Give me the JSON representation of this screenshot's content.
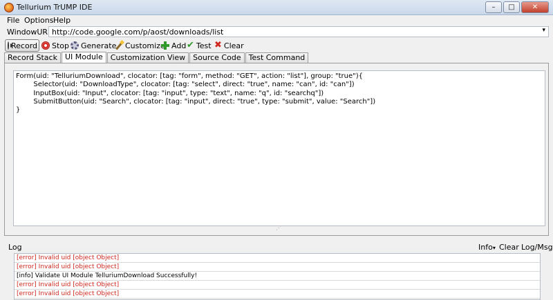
{
  "window": {
    "title": "Tellurium TrUMP IDE",
    "buttons": {
      "minimize": "–",
      "maximize": "□",
      "close": "✕"
    }
  },
  "menu": [
    "File",
    "Options",
    "Help"
  ],
  "url": {
    "label": "WindowURL",
    "value": "http://code.google.com/p/aost/downloads/list",
    "dropdown": "▾"
  },
  "toolbar": {
    "record": "Record",
    "stop": "Stop",
    "generate": "Generate",
    "customize": "Customize",
    "add": "Add",
    "test": "Test",
    "clear": "Clear"
  },
  "tabs": [
    "Record Stack",
    "UI Module",
    "Customization View",
    "Source Code",
    "Test Command"
  ],
  "active_tab": "UI Module",
  "code": "Form(uid: \"TelluriumDownload\", clocator: [tag: \"form\", method: \"GET\", action: \"list\"], group: \"true\"){\n        Selector(uid: \"DownloadType\", clocator: [tag: \"select\", direct: \"true\", name: \"can\", id: \"can\"])\n        InputBox(uid: \"Input\", clocator: [tag: \"input\", type: \"text\", name: \"q\", id: \"searchq\"])\n        SubmitButton(uid: \"Search\", clocator: [tag: \"input\", direct: \"true\", type: \"submit\", value: \"Search\"])\n}",
  "log": {
    "title": "Log",
    "level": "Info",
    "level_arrow": "▾",
    "clear": "Clear",
    "toggle": "Log/Msg",
    "entries": [
      {
        "level": "error",
        "text": "[error] Invalid uid [object Object]"
      },
      {
        "level": "error",
        "text": "[error] Invalid uid [object Object]"
      },
      {
        "level": "info",
        "text": "[info] Validate UI Module TelluriumDownload Successfully!"
      },
      {
        "level": "error",
        "text": "[error] Invalid uid [object Object]"
      },
      {
        "level": "error",
        "text": "[error] Invalid uid [object Object]"
      }
    ]
  }
}
